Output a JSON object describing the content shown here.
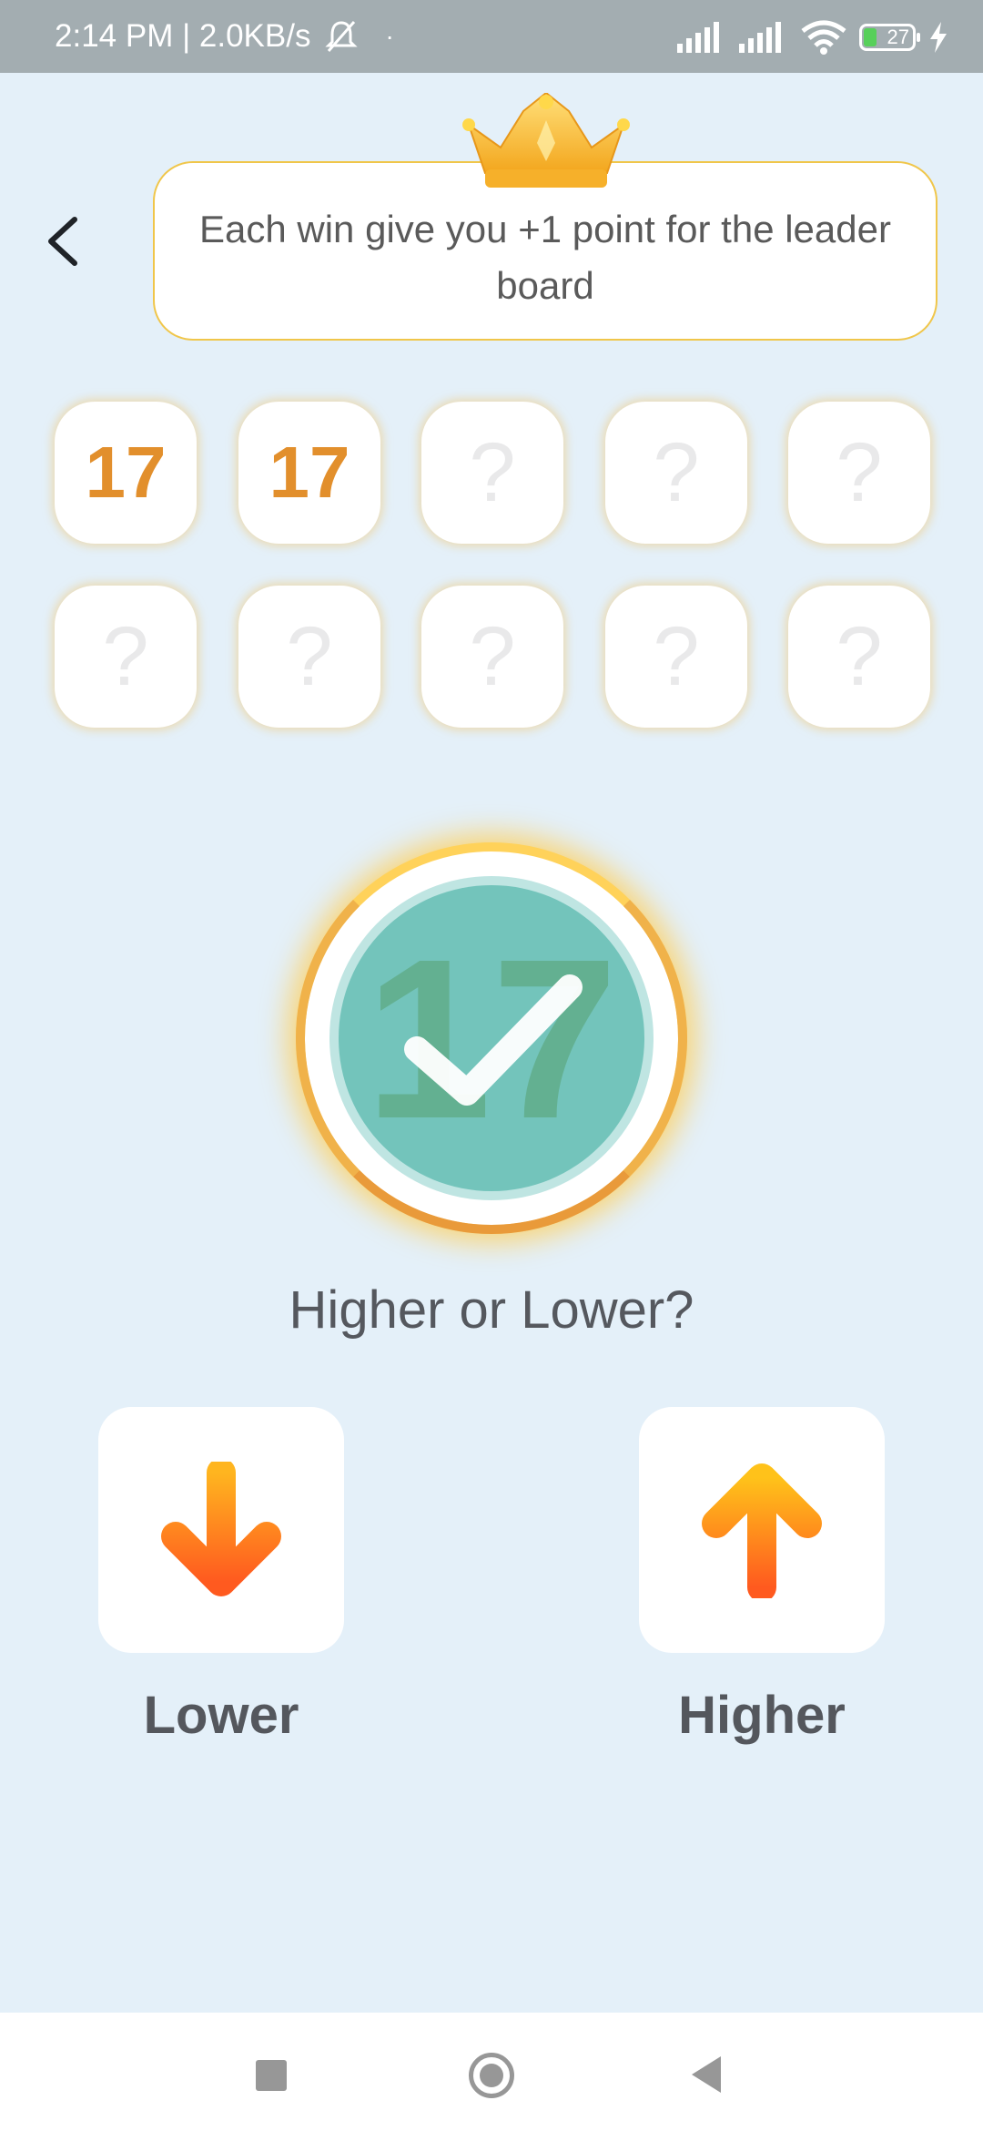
{
  "status_bar": {
    "time_speed": "2:14 PM | 2.0KB/s",
    "dot": "·",
    "battery": "27"
  },
  "banner": {
    "text": "Each win give you +1 point for the leader board"
  },
  "cards": [
    "17",
    "17",
    "?",
    "?",
    "?",
    "?",
    "?",
    "?",
    "?",
    "?"
  ],
  "current_number": "17",
  "question": "Higher or Lower?",
  "buttons": {
    "lower_label": "Lower",
    "higher_label": "Higher"
  },
  "colors": {
    "background": "#e4f0f9",
    "accent_orange": "#e28f2c",
    "teal": "#73c4bb",
    "gold": "#ffd25a"
  },
  "icons": {
    "back": "chevron-left-icon",
    "crown": "crown-icon",
    "check": "checkmark-icon",
    "lower": "arrow-down-icon",
    "higher": "arrow-up-icon"
  }
}
